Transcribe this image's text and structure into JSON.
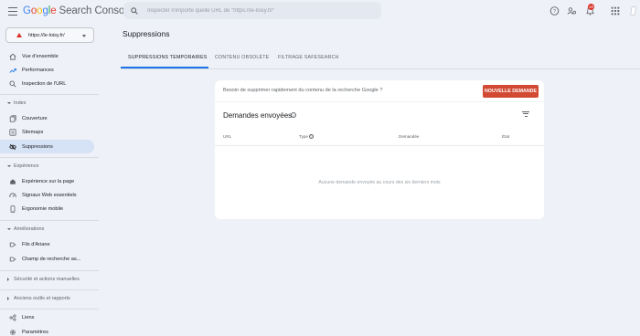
{
  "header": {
    "logo_google": "Google",
    "logo_product": "Search Console",
    "search_placeholder": "Inspecter n'importe quelle URL de \"https://le-loisy.fr/\"",
    "notifications_count": "10"
  },
  "sidebar": {
    "property": "https://le-loisy.fr/",
    "top_items": [
      {
        "label": "Vue d'ensemble",
        "icon": "home-icon"
      },
      {
        "label": "Performances",
        "icon": "trending-up-icon"
      },
      {
        "label": "Inspection de l'URL",
        "icon": "search-icon"
      }
    ],
    "index": {
      "heading": "Index",
      "items": [
        {
          "label": "Couverture",
          "icon": "coverage-icon"
        },
        {
          "label": "Sitemaps",
          "icon": "sitemap-icon"
        },
        {
          "label": "Suppressions",
          "icon": "eye-off-icon",
          "active": true
        }
      ]
    },
    "experience": {
      "heading": "Expérience",
      "items": [
        {
          "label": "Expérience sur la page",
          "icon": "experience-icon"
        },
        {
          "label": "Signaux Web essentiels",
          "icon": "speed-icon"
        },
        {
          "label": "Ergonomie mobile",
          "icon": "mobile-icon"
        }
      ]
    },
    "ameliorations": {
      "heading": "Améliorations",
      "items": [
        {
          "label": "Fils d'Ariane",
          "icon": "breadcrumb-icon"
        },
        {
          "label": "Champ de recherche as...",
          "icon": "sitelinks-search-icon"
        }
      ]
    },
    "security_heading": "Sécurité et actions manuelles",
    "legacy_heading": "Anciens outils et rapports",
    "bottom_items": [
      {
        "label": "Liens",
        "icon": "links-icon"
      },
      {
        "label": "Paramètres",
        "icon": "gear-icon"
      }
    ]
  },
  "main": {
    "page_title": "Suppressions",
    "tabs": [
      "SUPPRESSIONS TEMPORAIRES",
      "CONTENU OBSOLÈTE",
      "FILTRAGE SAFESEARCH"
    ],
    "banner_text": "Besoin de supprimer rapidement du contenu de la recherche Google ?",
    "new_request_label": "NOUVELLE DEMANDE",
    "card_title": "Demandes envoyées",
    "columns": [
      "URL",
      "Type",
      "Demandée",
      "État"
    ],
    "empty_message": "Aucune demande envoyée au cours des six derniers mois"
  },
  "colors": {
    "accent": "#1a73e8",
    "button": "#d24a33",
    "active_nav": "#d6e2f5",
    "background": "#eef1f7"
  }
}
